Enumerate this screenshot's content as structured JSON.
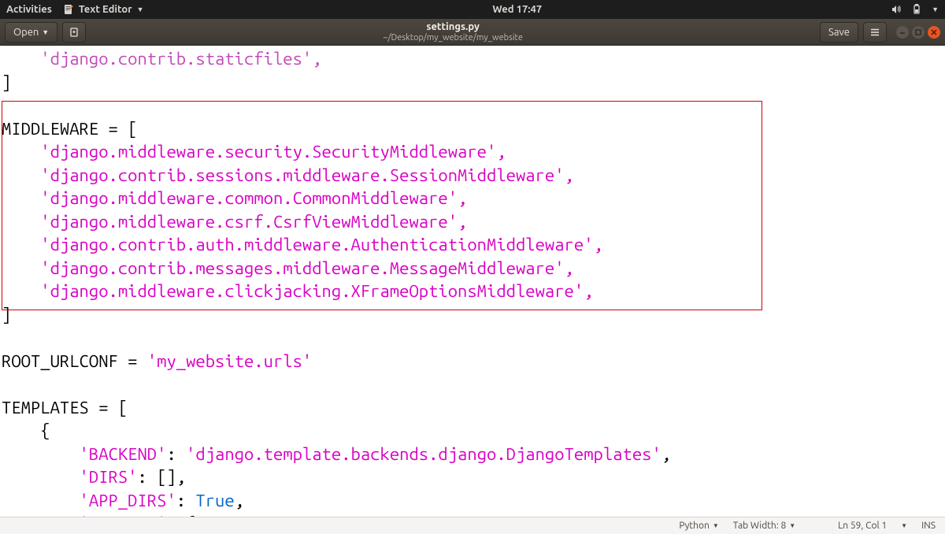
{
  "top_panel": {
    "activities": "Activities",
    "app_name": "Text Editor",
    "clock": "Wed 17:47"
  },
  "titlebar": {
    "open_label": "Open",
    "filename": "settings.py",
    "path": "~/Desktop/my_website/my_website",
    "save_label": "Save"
  },
  "editor": {
    "partial_line": "    'django.contrib.staticfiles',",
    "bracket_close": "]",
    "middleware_head": "MIDDLEWARE = [",
    "middleware": [
      "    'django.middleware.security.SecurityMiddleware',",
      "    'django.contrib.sessions.middleware.SessionMiddleware',",
      "    'django.middleware.common.CommonMiddleware',",
      "    'django.middleware.csrf.CsrfViewMiddleware',",
      "    'django.contrib.auth.middleware.AuthenticationMiddleware',",
      "    'django.contrib.messages.middleware.MessageMiddleware',",
      "    'django.middleware.clickjacking.XFrameOptionsMiddleware',"
    ],
    "blank": "",
    "root_urlconf_pre": "ROOT_URLCONF = ",
    "root_urlconf_str": "'my_website.urls'",
    "templates_head": "TEMPLATES = [",
    "templates_brace": "    {",
    "tmpl_backend_key": "        'BACKEND'",
    "tmpl_backend_sep": ": ",
    "tmpl_backend_val": "'django.template.backends.django.DjangoTemplates'",
    "tmpl_backend_end": ",",
    "tmpl_dirs_key": "        'DIRS'",
    "tmpl_dirs_rest": ": [],",
    "tmpl_appdirs_key": "        'APP_DIRS'",
    "tmpl_appdirs_sep": ": ",
    "tmpl_appdirs_val": "True",
    "tmpl_appdirs_end": ",",
    "tmpl_options_key": "        'OPTIONS'",
    "tmpl_options_rest": ": {"
  },
  "statusbar": {
    "language": "Python",
    "tab_width": "Tab Width: 8",
    "cursor": "Ln 59, Col 1",
    "ins": "INS"
  }
}
